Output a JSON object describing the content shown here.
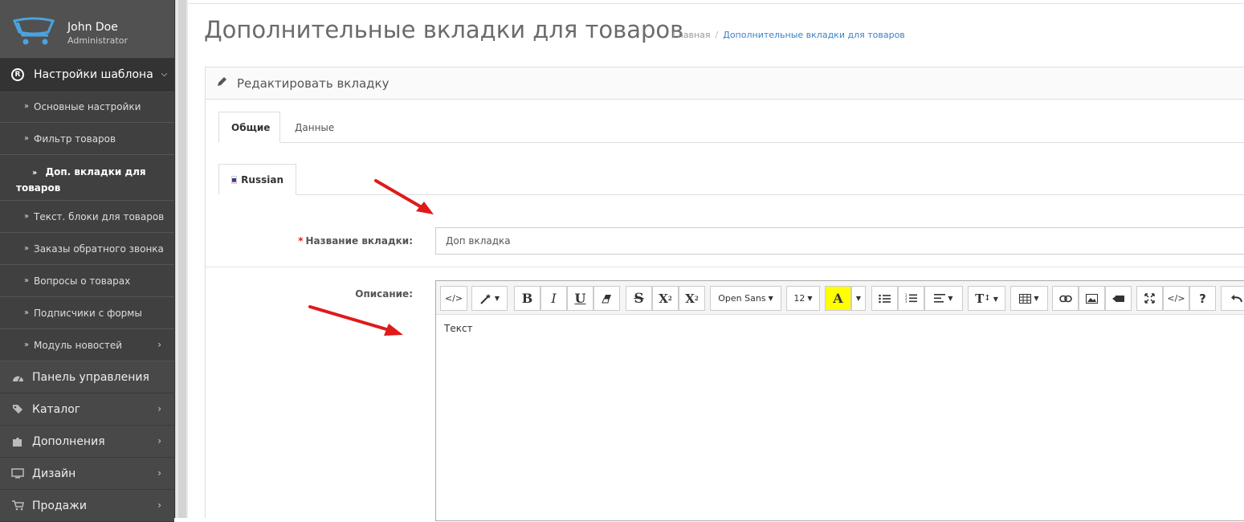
{
  "user": {
    "name": "John Doe",
    "role": "Administrator"
  },
  "sidebar": {
    "section": {
      "label": "Настройки шаблона"
    },
    "sub_items": [
      {
        "label": "Основные настройки"
      },
      {
        "label": "Фильтр товаров"
      },
      {
        "label": "Доп. вкладки для товаров",
        "active": true
      },
      {
        "label": "Текст. блоки для товаров"
      },
      {
        "label": "Заказы обратного звонка"
      },
      {
        "label": "Вопросы о товарах"
      },
      {
        "label": "Подписчики с формы"
      },
      {
        "label": "Модуль новостей"
      }
    ],
    "main_items": [
      {
        "label": "Панель управления",
        "icon": "dashboard-icon"
      },
      {
        "label": "Каталог",
        "icon": "tags-icon"
      },
      {
        "label": "Дополнения",
        "icon": "puzzle-icon"
      },
      {
        "label": "Дизайн",
        "icon": "monitor-icon"
      },
      {
        "label": "Продажи",
        "icon": "cart-icon"
      }
    ]
  },
  "header": {
    "title": "Дополнительные вкладки для товаров",
    "breadcrumb": {
      "home": "Главная",
      "separator": "/",
      "current": "Дополнительные вкладки для товаров"
    }
  },
  "panel": {
    "title": "Редактировать вкладку",
    "tabs": [
      {
        "label": "Общие",
        "active": true
      },
      {
        "label": "Данные"
      }
    ],
    "lang_tab": {
      "label": "Russian"
    }
  },
  "form": {
    "name_label": "Название вкладки:",
    "required_mark": "*",
    "name_value": "Доп вкладка",
    "description_label": "Описание:"
  },
  "editor": {
    "font_name": "Open Sans",
    "font_size": "12",
    "content": "Текст",
    "toolbar_icons": [
      "code-view-icon",
      "magic-wand-icon",
      "bold-icon",
      "italic-icon",
      "underline-icon",
      "eraser-icon",
      "strikethrough-icon",
      "superscript-icon",
      "subscript-icon",
      "font-family-select",
      "font-size-select",
      "text-color-icon",
      "color-caret-icon",
      "unordered-list-icon",
      "ordered-list-icon",
      "align-icon",
      "line-height-icon",
      "table-icon",
      "link-icon",
      "image-icon",
      "video-icon",
      "fullscreen-icon",
      "code-icon",
      "help-icon",
      "undo-icon"
    ]
  },
  "colors": {
    "sidebar": "#444444",
    "accent_link": "#3b82c4",
    "required": "#e02020",
    "annotation_arrow": "#e01919",
    "highlight": "#ffff00"
  }
}
